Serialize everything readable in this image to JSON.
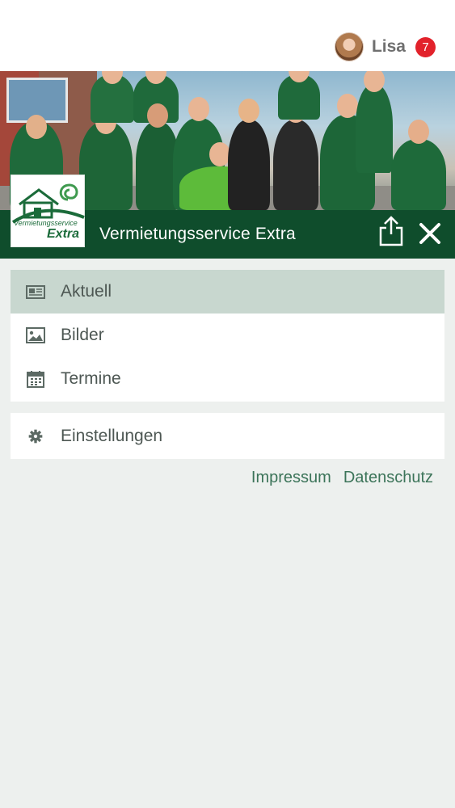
{
  "header": {
    "user_name": "Lisa",
    "notification_count": "7"
  },
  "brand": {
    "title": "Vermietungsservice Extra",
    "logo_small_text": "Vermietungsservice",
    "logo_large_text": "Extra",
    "accent_color": "#0f4d2c"
  },
  "menu": {
    "items": [
      {
        "label": "Aktuell",
        "icon": "newspaper-icon",
        "active": true
      },
      {
        "label": "Bilder",
        "icon": "image-icon",
        "active": false
      },
      {
        "label": "Termine",
        "icon": "calendar-icon",
        "active": false
      }
    ],
    "settings": {
      "label": "Einstellungen",
      "icon": "gear-icon"
    }
  },
  "footer": {
    "links": [
      "Impressum",
      "Datenschutz"
    ]
  }
}
